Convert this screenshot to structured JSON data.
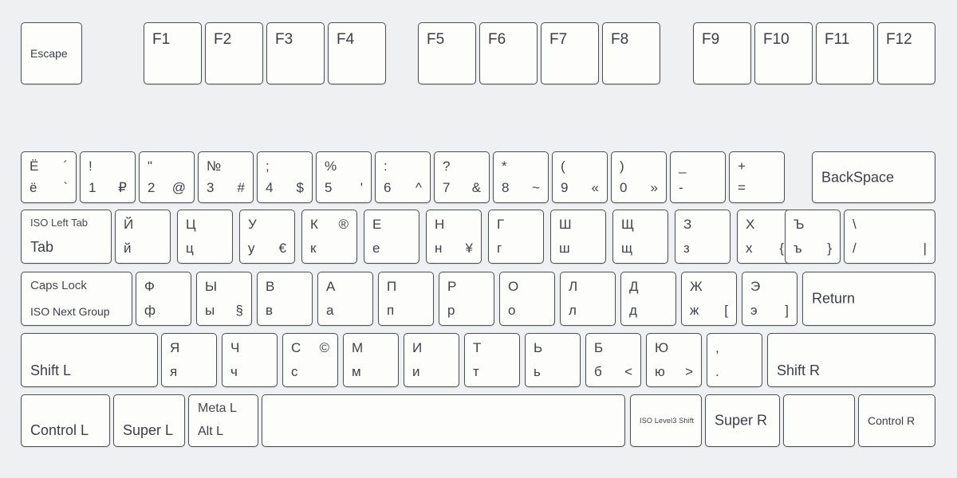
{
  "diagram": {
    "title": "Russian ISO keyboard layout",
    "background_color": "#eff0f1",
    "key_face_color": "#fdfdfc",
    "key_border_color": "#4c4f52",
    "text_color": "#3b3f45"
  },
  "function_row": {
    "escape": {
      "label": "Escape"
    },
    "group1": [
      {
        "label": "F1"
      },
      {
        "label": "F2"
      },
      {
        "label": "F3"
      },
      {
        "label": "F4"
      }
    ],
    "group2": [
      {
        "label": "F5"
      },
      {
        "label": "F6"
      },
      {
        "label": "F7"
      },
      {
        "label": "F8"
      }
    ],
    "group3": [
      {
        "label": "F9"
      },
      {
        "label": "F10"
      },
      {
        "label": "F11"
      },
      {
        "label": "F12"
      }
    ]
  },
  "number_row": [
    {
      "name": "tilde-key",
      "top_left": "Ё",
      "top_right": "´",
      "bottom_left": "ё",
      "bottom_right": "`"
    },
    {
      "name": "digit-1",
      "top_left": "!",
      "top_right": "",
      "bottom_left": "1",
      "bottom_right": "₽"
    },
    {
      "name": "digit-2",
      "top_left": "\"",
      "top_right": "",
      "bottom_left": "2",
      "bottom_right": "@"
    },
    {
      "name": "digit-3",
      "top_left": "№",
      "top_right": "",
      "bottom_left": "3",
      "bottom_right": "#"
    },
    {
      "name": "digit-4",
      "top_left": ";",
      "top_right": "",
      "bottom_left": "4",
      "bottom_right": "$"
    },
    {
      "name": "digit-5",
      "top_left": "%",
      "top_right": "",
      "bottom_left": "5",
      "bottom_right": "'"
    },
    {
      "name": "digit-6",
      "top_left": ":",
      "top_right": "",
      "bottom_left": "6",
      "bottom_right": "^"
    },
    {
      "name": "digit-7",
      "top_left": "?",
      "top_right": "",
      "bottom_left": "7",
      "bottom_right": "&"
    },
    {
      "name": "digit-8",
      "top_left": "*",
      "top_right": "",
      "bottom_left": "8",
      "bottom_right": "~"
    },
    {
      "name": "digit-9",
      "top_left": "(",
      "top_right": "",
      "bottom_left": "9",
      "bottom_right": "«"
    },
    {
      "name": "digit-0",
      "top_left": ")",
      "top_right": "",
      "bottom_left": "0",
      "bottom_right": "»"
    },
    {
      "name": "minus-key",
      "top_left": "_",
      "top_right": "",
      "bottom_left": "-",
      "bottom_right": ""
    },
    {
      "name": "equal-key",
      "top_left": "+",
      "top_right": "",
      "bottom_left": "=",
      "bottom_right": ""
    }
  ],
  "backspace": {
    "label": "BackSpace"
  },
  "tab_key": {
    "top_label": "ISO Left Tab",
    "bottom_label": "Tab"
  },
  "tab_row": [
    {
      "name": "key-shorty",
      "top_left": "Й",
      "top_right": "",
      "bottom_left": "й",
      "bottom_right": ""
    },
    {
      "name": "key-tse",
      "top_left": "Ц",
      "top_right": "",
      "bottom_left": "ц",
      "bottom_right": ""
    },
    {
      "name": "key-u",
      "top_left": "У",
      "top_right": "",
      "bottom_left": "у",
      "bottom_right": "€"
    },
    {
      "name": "key-ka",
      "top_left": "К",
      "top_right": "®",
      "bottom_left": "к",
      "bottom_right": ""
    },
    {
      "name": "key-ie",
      "top_left": "Е",
      "top_right": "",
      "bottom_left": "е",
      "bottom_right": ""
    },
    {
      "name": "key-en",
      "top_left": "Н",
      "top_right": "",
      "bottom_left": "н",
      "bottom_right": "¥"
    },
    {
      "name": "key-ghe",
      "top_left": "Г",
      "top_right": "",
      "bottom_left": "г",
      "bottom_right": ""
    },
    {
      "name": "key-sha",
      "top_left": "Ш",
      "top_right": "",
      "bottom_left": "ш",
      "bottom_right": ""
    },
    {
      "name": "key-shcha",
      "top_left": "Щ",
      "top_right": "",
      "bottom_left": "щ",
      "bottom_right": ""
    },
    {
      "name": "key-ze",
      "top_left": "З",
      "top_right": "",
      "bottom_left": "з",
      "bottom_right": ""
    },
    {
      "name": "key-ha",
      "top_left": "Х",
      "top_right": "",
      "bottom_left": "х",
      "bottom_right": "{"
    },
    {
      "name": "key-hard",
      "top_left": "Ъ",
      "top_right": "",
      "bottom_left": "ъ",
      "bottom_right": "}"
    },
    {
      "name": "key-backslash",
      "top_left": "\\",
      "top_right": "",
      "bottom_left": "/",
      "bottom_right": "|"
    }
  ],
  "caps_key": {
    "top_label": "Caps Lock",
    "bottom_label": "ISO Next Group"
  },
  "home_row": [
    {
      "name": "key-ef",
      "top_left": "Ф",
      "top_right": "",
      "bottom_left": "ф",
      "bottom_right": ""
    },
    {
      "name": "key-yeru",
      "top_left": "Ы",
      "top_right": "",
      "bottom_left": "ы",
      "bottom_right": "§"
    },
    {
      "name": "key-ve",
      "top_left": "В",
      "top_right": "",
      "bottom_left": "в",
      "bottom_right": ""
    },
    {
      "name": "key-a",
      "top_left": "А",
      "top_right": "",
      "bottom_left": "а",
      "bottom_right": ""
    },
    {
      "name": "key-pe",
      "top_left": "П",
      "top_right": "",
      "bottom_left": "п",
      "bottom_right": ""
    },
    {
      "name": "key-er",
      "top_left": "Р",
      "top_right": "",
      "bottom_left": "р",
      "bottom_right": ""
    },
    {
      "name": "key-o",
      "top_left": "О",
      "top_right": "",
      "bottom_left": "о",
      "bottom_right": ""
    },
    {
      "name": "key-el",
      "top_left": "Л",
      "top_right": "",
      "bottom_left": "л",
      "bottom_right": ""
    },
    {
      "name": "key-de",
      "top_left": "Д",
      "top_right": "",
      "bottom_left": "д",
      "bottom_right": ""
    },
    {
      "name": "key-zhe",
      "top_left": "Ж",
      "top_right": "",
      "bottom_left": "ж",
      "bottom_right": "["
    },
    {
      "name": "key-e",
      "top_left": "Э",
      "top_right": "",
      "bottom_left": "э",
      "bottom_right": "]"
    }
  ],
  "return_key": {
    "label": "Return"
  },
  "shift_left": {
    "label": "Shift L"
  },
  "shift_row": [
    {
      "name": "key-ya",
      "top_left": "Я",
      "top_right": "",
      "bottom_left": "я",
      "bottom_right": ""
    },
    {
      "name": "key-che",
      "top_left": "Ч",
      "top_right": "",
      "bottom_left": "ч",
      "bottom_right": ""
    },
    {
      "name": "key-es",
      "top_left": "С",
      "top_right": "©",
      "bottom_left": "с",
      "bottom_right": ""
    },
    {
      "name": "key-em",
      "top_left": "М",
      "top_right": "",
      "bottom_left": "м",
      "bottom_right": ""
    },
    {
      "name": "key-i",
      "top_left": "И",
      "top_right": "",
      "bottom_left": "и",
      "bottom_right": ""
    },
    {
      "name": "key-te",
      "top_left": "Т",
      "top_right": "",
      "bottom_left": "т",
      "bottom_right": ""
    },
    {
      "name": "key-soft",
      "top_left": "Ь",
      "top_right": "",
      "bottom_left": "ь",
      "bottom_right": ""
    },
    {
      "name": "key-be",
      "top_left": "Б",
      "top_right": "",
      "bottom_left": "б",
      "bottom_right": "<"
    },
    {
      "name": "key-yu",
      "top_left": "Ю",
      "top_right": "",
      "bottom_left": "ю",
      "bottom_right": ">"
    },
    {
      "name": "key-period",
      "top_left": ",",
      "top_right": "",
      "bottom_left": ".",
      "bottom_right": ""
    }
  ],
  "shift_right": {
    "label": "Shift R"
  },
  "bottom_row": {
    "control_left": {
      "label": "Control L"
    },
    "super_left": {
      "label": "Super L"
    },
    "meta_alt_left": {
      "top_label": "Meta L",
      "bottom_label": "Alt L"
    },
    "space": {
      "label": ""
    },
    "level3_shift": {
      "label": "ISO Level3 Shift"
    },
    "super_right": {
      "label": "Super R"
    },
    "menu": {
      "label": ""
    },
    "control_right": {
      "label": "Control R"
    }
  }
}
